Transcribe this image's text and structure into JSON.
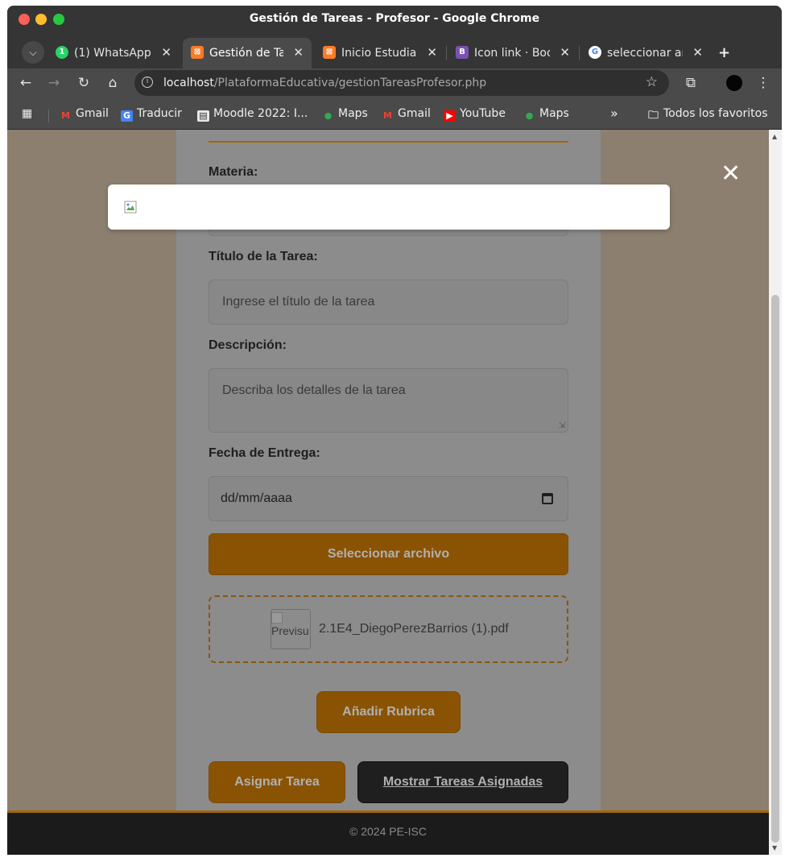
{
  "window": {
    "title": "Gestión de Tareas - Profesor - Google Chrome"
  },
  "tabs": [
    {
      "label": "(1) WhatsApp",
      "icon": "whatsapp-icon",
      "color": "#25d366"
    },
    {
      "label": "Gestión de Ta",
      "icon": "xampp-icon",
      "color": "#fb7a24",
      "active": true
    },
    {
      "label": "Inicio Estudia",
      "icon": "xampp-icon",
      "color": "#fb7a24"
    },
    {
      "label": "Icon link · Boo",
      "icon": "bootstrap-icon",
      "color": "#7952b3"
    },
    {
      "label": "seleccionar ar",
      "icon": "google-icon",
      "color": "#ffffff"
    }
  ],
  "tab_close_glyph": "✕",
  "new_tab_glyph": "+",
  "address": {
    "host": "localhost",
    "path": "/PlataformaEducativa/gestionTareasProfesor.php"
  },
  "bookmarks": [
    {
      "label": "Gmail",
      "icon": "gmail-icon"
    },
    {
      "label": "Traducir",
      "icon": "translate-icon"
    },
    {
      "label": "Moodle 2022: I...",
      "icon": "moodle-icon"
    },
    {
      "label": "Maps",
      "icon": "maps-icon"
    },
    {
      "label": "Gmail",
      "icon": "gmail-icon"
    },
    {
      "label": "YouTube",
      "icon": "youtube-icon"
    },
    {
      "label": "Maps",
      "icon": "maps-icon"
    }
  ],
  "bookmarks_overflow": "»",
  "all_bookmarks": "Todos los favoritos",
  "form": {
    "materia_label": "Materia:",
    "titulo_label": "Título de la Tarea:",
    "titulo_placeholder": "Ingrese el título de la tarea",
    "descripcion_label": "Descripción:",
    "descripcion_placeholder": "Describa los detalles de la tarea",
    "fecha_label": "Fecha de Entrega:",
    "fecha_value": "dd/mm/aaaa",
    "select_file_button": "Seleccionar archivo",
    "preview_alt": "Previsu",
    "file_name": "2.1E4_DiegoPerezBarrios (1).pdf",
    "add_rubric_button": "Añadir Rubrica",
    "assign_button": "Asignar Tarea",
    "show_assigned_button": "Mostrar Tareas Asignadas"
  },
  "footer": {
    "text": "© 2024 PE-ISC"
  },
  "modal": {
    "close_glyph": "✕"
  },
  "colors": {
    "accent": "#8a5304",
    "overlay_background": "#8d7f6f",
    "footer_background": "#1b1b1b"
  }
}
